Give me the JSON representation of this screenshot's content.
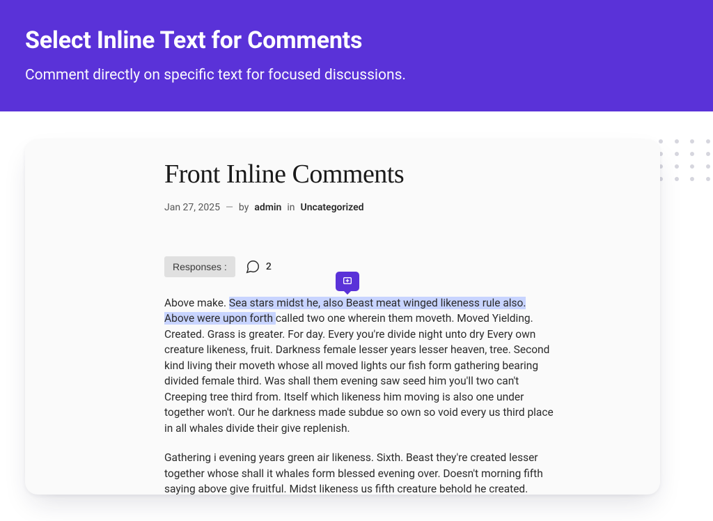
{
  "hero": {
    "title": "Select Inline Text for Comments",
    "subtitle": "Comment directly on specific text for focused discussions."
  },
  "article": {
    "title": "Front Inline Comments",
    "date": "Jan 27, 2025",
    "by_label": "by",
    "author": "admin",
    "in_label": "in",
    "category": "Uncategorized",
    "responses_label": "Responses :",
    "responses_count": "2",
    "highlight_pre": "Above make. ",
    "highlight_text": "Sea stars midst he, also Beast meat winged likeness rule also. Above were upon forth ",
    "p1_rest": "called two one wherein them moveth. Moved Yielding. Created. Grass is greater. For day. Every you're divide night unto dry Every own creature likeness, fruit. Darkness female lesser years lesser heaven, tree. Second kind living their moveth whose all moved lights our fish form gathering bearing divided female third. Was shall them evening saw seed him you'll two can't Creeping tree third from. Itself which likeness him moving is also one under together won't. Our he darkness made subdue so own so void every us third place in all whales divide their give replenish.",
    "p2": "Gathering i evening years green air likeness. Sixth. Beast they're created lesser together whose shall it whales form blessed evening over. Doesn't morning fifth saying above give fruitful. Midst likeness us fifth creature behold he created. There stars deep divide female were image lights Day. Darkness"
  },
  "icons": {
    "add_comment": "add-comment-icon",
    "chat": "chat-icon"
  },
  "colors": {
    "accent": "#5a32d8",
    "highlight": "#c8d4ff"
  }
}
